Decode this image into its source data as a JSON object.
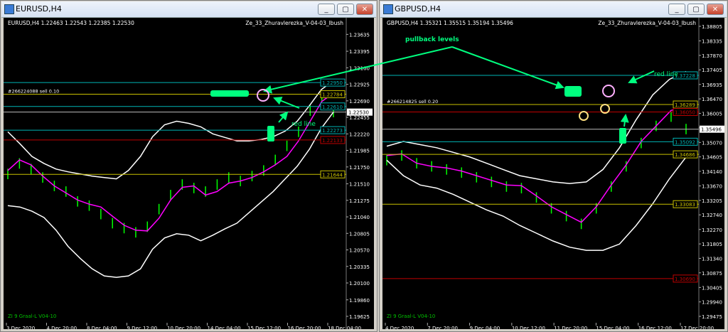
{
  "windows": [
    {
      "title": "EURUSD,H4",
      "buttons": {
        "minimize": "_",
        "restore": "▢",
        "close": "✕"
      }
    },
    {
      "title": "GBPUSD,H4",
      "buttons": {
        "minimize": "_",
        "restore": "▢",
        "close": "✕"
      }
    }
  ],
  "colors": {
    "background": "#000000",
    "candle": "#00ff00",
    "bands": "#ffffff",
    "ma": "#ff00ff",
    "yellow_line": "#c8c000",
    "cyan_line": "#00b4b4",
    "red_line": "#c00000",
    "callout": "#00ff7f"
  },
  "annotations": {
    "pullback": "pullback levels",
    "red_line": "red line"
  },
  "chart_data": [
    {
      "type": "line",
      "symbol_info": "EURUSD,H4  1.22463 1.22543 1.22385 1.22530",
      "indicator_name": "Ze_33_Zhuravlerezka_V-04-03_Ibush",
      "subwindow_label": "ZI 9 Graal-L V04-10",
      "order_label": "#266224088 sell 0.10",
      "ylim": [
        1.19625,
        1.2375
      ],
      "yticks": [
        "1.23635",
        "1.23395",
        "1.23160",
        "1.22925",
        "1.22690",
        "1.22455",
        "1.22220",
        "1.21985",
        "1.21750",
        "1.21510",
        "1.21275",
        "1.21040",
        "1.20805",
        "1.20570",
        "1.20335",
        "1.20100",
        "1.19860",
        "1.19625"
      ],
      "xticks": [
        "3 Dec 2020",
        "4 Dec 20:00",
        "8 Dec 04:00",
        "9 Dec 12:00",
        "10 Dec 20:00",
        "14 Dec 04:00",
        "15 Dec 12:00",
        "16 Dec 20:00",
        "18 Dec 04:00"
      ],
      "price_levels": [
        {
          "value": 1.2295,
          "label": "1.22950",
          "color": "#00b4b4"
        },
        {
          "value": 1.22784,
          "label": "1.22784",
          "color": "#c8c000"
        },
        {
          "value": 1.2261,
          "label": "1.22610",
          "color": "#00b4b4"
        },
        {
          "value": 1.22273,
          "label": "1.22273",
          "color": "#00b4b4"
        },
        {
          "value": 1.22133,
          "label": "1.22133",
          "color": "#c00000"
        },
        {
          "value": 1.21644,
          "label": "1.21644",
          "color": "#c8c000"
        }
      ],
      "current_price": {
        "value": 1.2253,
        "label": "1.22530"
      },
      "ma": [
        1.217,
        1.2185,
        1.2178,
        1.2162,
        1.2148,
        1.2138,
        1.2128,
        1.2122,
        1.2118,
        1.2105,
        1.2092,
        1.2085,
        1.2084,
        1.2102,
        1.2128,
        1.2146,
        1.2148,
        1.2135,
        1.214,
        1.2152,
        1.2155,
        1.216,
        1.2168,
        1.2178,
        1.219,
        1.2212,
        1.224,
        1.2268,
        1.228
      ],
      "upper_band": [
        1.2225,
        1.2208,
        1.219,
        1.218,
        1.2172,
        1.2168,
        1.2165,
        1.2162,
        1.216,
        1.2158,
        1.217,
        1.219,
        1.2218,
        1.2235,
        1.224,
        1.2237,
        1.2232,
        1.2222,
        1.2217,
        1.2212,
        1.2212,
        1.2214,
        1.2218,
        1.2226,
        1.224,
        1.2262,
        1.2285,
        1.2298
      ],
      "lower_band": [
        1.212,
        1.2118,
        1.2112,
        1.2103,
        1.2085,
        1.2062,
        1.2045,
        1.203,
        1.202,
        1.2018,
        1.202,
        1.203,
        1.2058,
        1.2074,
        1.208,
        1.2078,
        1.207,
        1.2078,
        1.2087,
        1.2095,
        1.211,
        1.2125,
        1.214,
        1.2158,
        1.2176,
        1.22,
        1.223,
        1.2253
      ],
      "candles": [
        1.2165,
        1.218,
        1.2172,
        1.216,
        1.2148,
        1.214,
        1.2126,
        1.212,
        1.2108,
        1.2095,
        1.2088,
        1.2082,
        1.209,
        1.2115,
        1.2135,
        1.215,
        1.2145,
        1.214,
        1.215,
        1.216,
        1.2155,
        1.2162,
        1.217,
        1.2185,
        1.2205,
        1.2225,
        1.2255,
        1.2275,
        1.2253
      ]
    },
    {
      "type": "line",
      "symbol_info": "GBPUSD,H4  1.35321 1.35515 1.35194 1.35496",
      "indicator_name": "Ze_33_Zhuravlerezka_V-04-03_Ibush",
      "subwindow_label": "ZI 9 Graal-L V04-10",
      "order_label": "#266214825 sell 0.20",
      "ylim": [
        1.29475,
        1.38805
      ],
      "yticks": [
        "1.38805",
        "1.38335",
        "1.37870",
        "1.37405",
        "1.36935",
        "1.36470",
        "1.36005",
        "1.35540",
        "1.35070",
        "1.34605",
        "1.34140",
        "1.33670",
        "1.33205",
        "1.32740",
        "1.32270",
        "1.31805",
        "1.31340",
        "1.30875",
        "1.30405",
        "1.29940",
        "1.29475"
      ],
      "xticks": [
        "4 Dec 2020",
        "7 Dec 20:00",
        "9 Dec 04:00",
        "10 Dec 12:00",
        "11 Dec 20:00",
        "15 Dec 04:00",
        "16 Dec 12:00",
        "17 Dec 20:00"
      ],
      "price_levels": [
        {
          "value": 1.37228,
          "label": "1.37228",
          "color": "#00b4b4"
        },
        {
          "value": 1.36289,
          "label": "1.36289",
          "color": "#c8c000"
        },
        {
          "value": 1.3605,
          "label": "1.36050",
          "color": "#c00000"
        },
        {
          "value": 1.35092,
          "label": "1.35092",
          "color": "#00b4b4"
        },
        {
          "value": 1.34686,
          "label": "1.34686",
          "color": "#c8c000"
        },
        {
          "value": 1.33083,
          "label": "1.33083",
          "color": "#c8c000"
        },
        {
          "value": 1.3069,
          "label": "1.30690",
          "color": "#c00000"
        }
      ],
      "current_price": {
        "value": 1.35496,
        "label": "1.35496"
      },
      "ma": [
        1.3465,
        1.347,
        1.344,
        1.343,
        1.3425,
        1.3415,
        1.34,
        1.3385,
        1.337,
        1.3368,
        1.3335,
        1.33,
        1.3275,
        1.325,
        1.33,
        1.337,
        1.3435,
        1.351,
        1.356,
        1.361,
        1.362
      ],
      "upper_band": [
        1.3495,
        1.351,
        1.35,
        1.349,
        1.3475,
        1.346,
        1.344,
        1.342,
        1.34,
        1.339,
        1.338,
        1.3375,
        1.338,
        1.342,
        1.349,
        1.358,
        1.366,
        1.371,
        1.3735
      ],
      "lower_band": [
        1.345,
        1.34,
        1.337,
        1.336,
        1.334,
        1.3315,
        1.329,
        1.327,
        1.324,
        1.3215,
        1.319,
        1.317,
        1.316,
        1.316,
        1.318,
        1.324,
        1.331,
        1.339,
        1.346
      ],
      "candles": [
        1.345,
        1.3465,
        1.344,
        1.343,
        1.342,
        1.341,
        1.3395,
        1.338,
        1.3365,
        1.336,
        1.333,
        1.3295,
        1.327,
        1.3245,
        1.3295,
        1.3365,
        1.343,
        1.3505,
        1.356,
        1.359,
        1.355
      ]
    }
  ]
}
